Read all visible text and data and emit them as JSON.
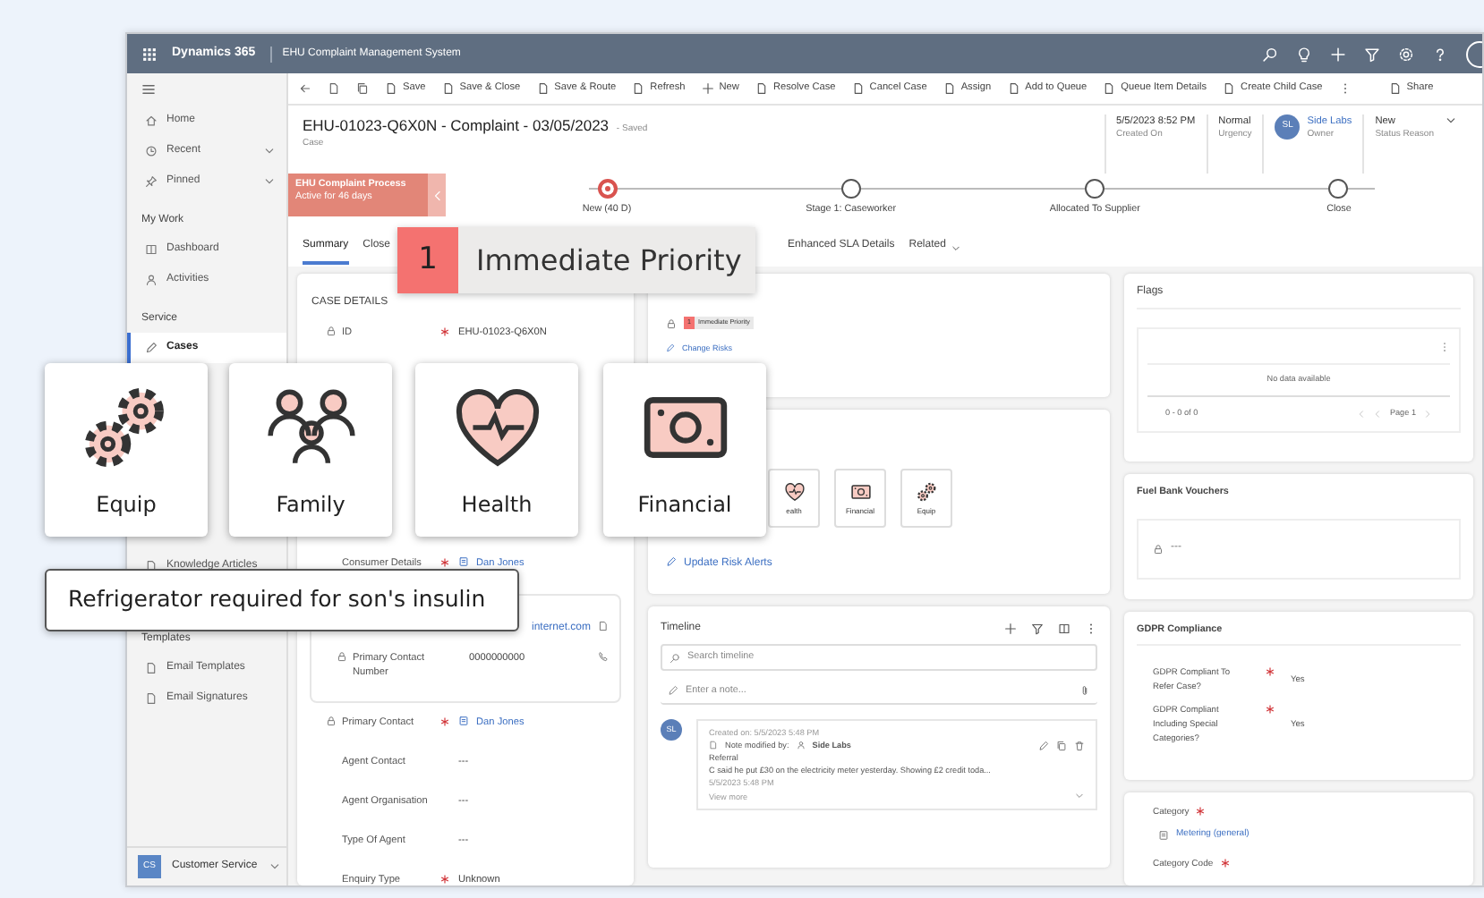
{
  "app": {
    "brand": "Dynamics 365",
    "title": "EHU Complaint Management System"
  },
  "commands": [
    "Save",
    "Save & Close",
    "Save & Route",
    "Refresh",
    "New",
    "Resolve Case",
    "Cancel Case",
    "Assign",
    "Add to Queue",
    "Queue Item Details",
    "Create Child Case",
    "Share"
  ],
  "sidebar": {
    "sections": [
      {
        "items": [
          {
            "label": "Home",
            "kind": "link",
            "selected": false
          },
          {
            "label": "Recent",
            "kind": "expander",
            "selected": false
          },
          {
            "label": "Pinned",
            "kind": "expander",
            "selected": false
          },
          {
            "label": "My Work",
            "kind": "heading"
          },
          {
            "label": "Dashboard",
            "kind": "link",
            "selected": false
          },
          {
            "label": "Activities",
            "kind": "link",
            "selected": false
          },
          {
            "label": "Service",
            "kind": "heading"
          },
          {
            "label": "Cases",
            "kind": "link",
            "selected": true
          }
        ]
      },
      {
        "items": [
          {
            "label": "Knowledge Articles",
            "kind": "link",
            "selected": false
          }
        ]
      },
      {
        "items": [
          {
            "label": "Templates",
            "kind": "heading"
          },
          {
            "label": "Email Templates",
            "kind": "link",
            "selected": false
          },
          {
            "label": "Email Signatures",
            "kind": "link",
            "selected": false
          }
        ]
      }
    ],
    "area": {
      "initials": "CS",
      "label": "Customer Service"
    }
  },
  "record": {
    "title": "EHU-01023-Q6X0N - Complaint - 03/05/2023",
    "status": "- Saved",
    "entity": "Case",
    "fields": [
      {
        "value": "5/5/2023 8:52 PM",
        "label": "Created On"
      },
      {
        "value": "Normal",
        "label": "Urgency"
      }
    ],
    "owner": {
      "initials": "SL",
      "name": "Side Labs",
      "label": "Owner"
    },
    "status_reason": {
      "value": "New",
      "label": "Status Reason"
    }
  },
  "process": {
    "name": "EHU Complaint Process",
    "duration": "Active for 46 days",
    "stages": [
      {
        "label": "New (40 D)",
        "selected": true
      },
      {
        "label": "Stage 1: Caseworker",
        "selected": false
      },
      {
        "label": "Allocated To Supplier",
        "selected": false
      },
      {
        "label": "Close",
        "selected": false
      }
    ]
  },
  "tabs": [
    {
      "label": "Summary",
      "selected": true
    },
    {
      "label": "Close",
      "selected": false
    },
    {
      "label": "Enhanced SLA Details",
      "selected": false
    },
    {
      "label": "Related",
      "selected": false
    }
  ],
  "case_details": {
    "title": "CASE DETAILS",
    "fields_top": [
      {
        "label": "ID",
        "value": "EHU-01023-Q6X0N",
        "kind": "text",
        "required": true,
        "locked": true
      }
    ],
    "fields": [
      {
        "label": "Consumer Details",
        "value": "Dan Jones",
        "kind": "lookup",
        "required": true,
        "locked": false
      }
    ],
    "contact": {
      "email": "internet.com",
      "phone_label": "Primary Contact Number",
      "phone": "0000000000"
    },
    "fields_bottom": [
      {
        "label": "Primary Contact",
        "value": "Dan Jones",
        "kind": "lookup",
        "required": true,
        "locked": true
      },
      {
        "label": "Agent Contact",
        "value": "---",
        "kind": "text",
        "required": false,
        "locked": false
      },
      {
        "label": "Agent Organisation",
        "value": "---",
        "kind": "text",
        "required": false,
        "locked": false
      },
      {
        "label": "Type Of Agent",
        "value": "---",
        "kind": "text",
        "required": false,
        "locked": false
      },
      {
        "label": "Enquiry Type",
        "value": "Unknown",
        "kind": "text",
        "required": true,
        "locked": false
      }
    ]
  },
  "risk": {
    "priority": {
      "number": "1",
      "label": "Immediate Priority"
    },
    "link": "Change Risks",
    "alerts": [
      {
        "kind": "health",
        "label": "ealth"
      },
      {
        "kind": "financial",
        "label": "Financial"
      },
      {
        "kind": "equip",
        "label": "Equip"
      }
    ],
    "alerts_link": "Update Risk Alerts"
  },
  "timeline": {
    "title": "Timeline",
    "search": "Search timeline",
    "note": "Enter a note...",
    "entries": [
      {
        "initials": "SL",
        "created": "Created on: 5/5/2023 5:48 PM",
        "modified": "Note modified by:",
        "author": "Side Labs",
        "subject": "Referral",
        "body": "C said he put £30 on the electricity meter yesterday. Showing £2 credit toda...",
        "time": "5/5/2023 5:48 PM",
        "more": "View more"
      }
    ]
  },
  "flags": {
    "title": "Flags",
    "empty": "No data available",
    "range": "0 - 0 of 0",
    "page": "Page 1"
  },
  "fuel": {
    "title": "Fuel Bank Vouchers",
    "value": "---"
  },
  "gdpr": {
    "title": "GDPR Compliance",
    "fields": [
      {
        "label": "GDPR Compliant To Refer Case?",
        "value": "Yes",
        "required": true
      },
      {
        "label": "GDPR Compliant Including Special Categories?",
        "value": "Yes",
        "required": true
      }
    ]
  },
  "category": {
    "fields": [
      {
        "label": "Category",
        "value": "Metering (general)",
        "required": true
      },
      {
        "label": "Category Code",
        "required": true
      }
    ]
  },
  "overlay": {
    "callout": {
      "number": "1",
      "label": "Immediate Priority"
    },
    "alert_cards": [
      {
        "kind": "equip",
        "label": "Equip"
      },
      {
        "kind": "family",
        "label": "Family"
      },
      {
        "kind": "health",
        "label": "Health"
      },
      {
        "kind": "financial",
        "label": "Financial"
      }
    ],
    "tooltip": "Refrigerator required for son's insulin"
  }
}
